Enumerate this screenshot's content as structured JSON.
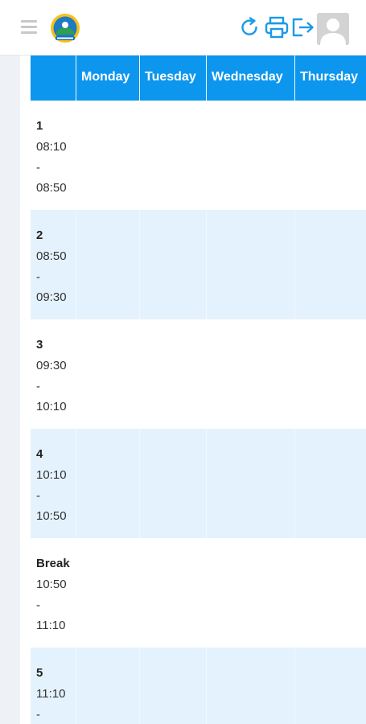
{
  "header": {
    "menu_icon": "hamburger-icon",
    "logo_icon": "school-crest-logo",
    "refresh_icon": "refresh-icon",
    "print_icon": "printer-icon",
    "logout_icon": "logout-icon",
    "avatar_icon": "user-avatar-icon"
  },
  "colors": {
    "header_bg": "#0d96ee",
    "alt_row_bg": "#e4f2fd",
    "icon_blue": "#1a9ae8"
  },
  "timetable": {
    "columns": [
      "",
      "Monday",
      "Tuesday",
      "Wednesday",
      "Thursday"
    ],
    "periods": [
      {
        "label": "1",
        "start": "08:10",
        "sep": "-",
        "end": "08:50"
      },
      {
        "label": "2",
        "start": "08:50",
        "sep": "-",
        "end": "09:30"
      },
      {
        "label": "3",
        "start": "09:30",
        "sep": "-",
        "end": "10:10"
      },
      {
        "label": "4",
        "start": "10:10",
        "sep": "-",
        "end": "10:50"
      },
      {
        "label": "Break",
        "start": "10:50",
        "sep": "-",
        "end": "11:10"
      },
      {
        "label": "5",
        "start": "11:10",
        "sep": "-",
        "end": ""
      }
    ]
  }
}
